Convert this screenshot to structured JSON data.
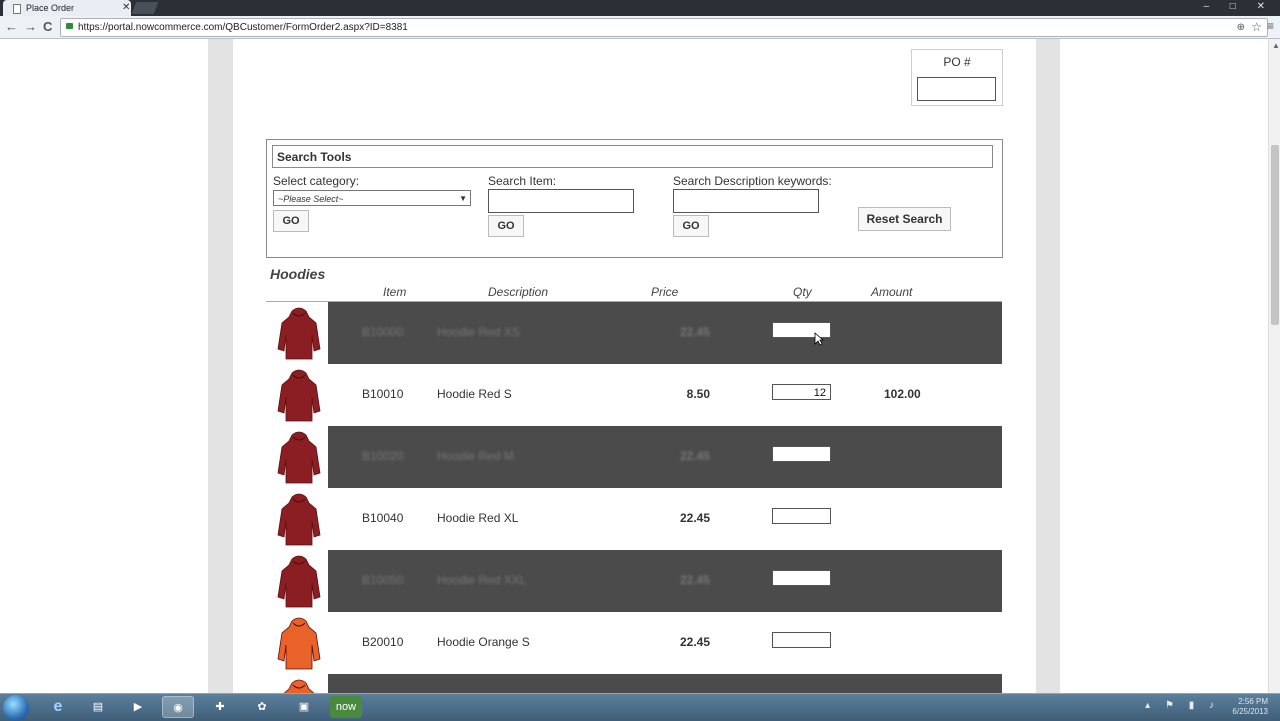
{
  "browser": {
    "tab_title": "Place Order",
    "tab_close": "✕",
    "url": "https://portal.nowcommerce.com/QBCustomer/FormOrder2.aspx?ID=8381",
    "back": "←",
    "forward": "→",
    "reload": "C",
    "zoom_icon": "⊕",
    "star_icon": "☆",
    "menu_icon": "≡",
    "window_controls": "‒ □ ✕"
  },
  "po": {
    "label": "PO #",
    "value": ""
  },
  "search_tools": {
    "header": "Search Tools",
    "category_label": "Select category:",
    "category_selected": "~Please Select~",
    "item_label": "Search Item:",
    "description_label": "Search Description keywords:",
    "go_label": "GO",
    "reset_label": "Reset Search"
  },
  "category": {
    "title": "Hoodies"
  },
  "columns": {
    "item": "Item",
    "description": "Description",
    "price": "Price",
    "qty": "Qty",
    "amount": "Amount"
  },
  "rows": [
    {
      "item": "B10000",
      "description": "Hoodie Red XS",
      "price": "22.45",
      "qty": "",
      "amount": "",
      "shaded": true
    },
    {
      "item": "B10010",
      "description": "Hoodie Red S",
      "price": "8.50",
      "qty": "12",
      "amount": "102.00",
      "shaded": false
    },
    {
      "item": "B10020",
      "description": "Hoodie Red M",
      "price": "22.45",
      "qty": "",
      "amount": "",
      "shaded": true
    },
    {
      "item": "B10040",
      "description": "Hoodie Red XL",
      "price": "22.45",
      "qty": "",
      "amount": "",
      "shaded": false
    },
    {
      "item": "B10050",
      "description": "Hoodie Red XXL",
      "price": "22.45",
      "qty": "",
      "amount": "",
      "shaded": true
    },
    {
      "item": "B20010",
      "description": "Hoodie Orange S",
      "price": "22.45",
      "qty": "",
      "amount": "",
      "shaded": false
    },
    {
      "item": "",
      "description": "",
      "price": "",
      "qty": "",
      "amount": "",
      "shaded": true
    }
  ],
  "colors": {
    "shaded_row": "#4b4b4b",
    "hoodie_red": "#8b1e22",
    "hoodie_orange": "#e8622a"
  },
  "taskbar": {
    "now_label": "now",
    "clock_time": "2:56 PM",
    "clock_date": "6/25/2013"
  }
}
